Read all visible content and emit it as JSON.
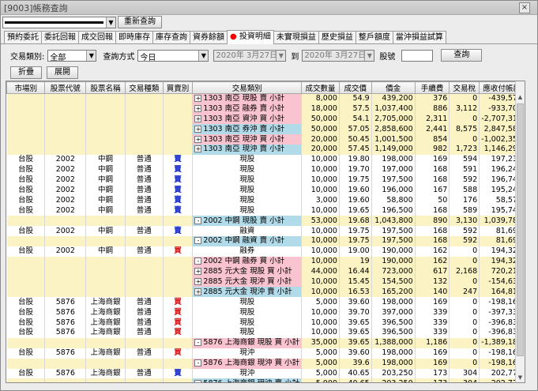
{
  "window": {
    "title": "[9003]帳務查詢",
    "close_glyph": "×"
  },
  "toolbar": {
    "account_value": "",
    "refresh_label": "重新查詢"
  },
  "tabs": [
    {
      "label": "預約委託"
    },
    {
      "label": "委託回報"
    },
    {
      "label": "成交回報"
    },
    {
      "label": "即時庫存"
    },
    {
      "label": "庫存查詢"
    },
    {
      "label": "資券餘額"
    },
    {
      "label": "投資明細",
      "active": true
    },
    {
      "label": "未實現損益"
    },
    {
      "label": "歷史損益"
    },
    {
      "label": "整戶額度"
    },
    {
      "label": "當沖損益試算"
    }
  ],
  "filter": {
    "type_label": "交易類別:",
    "type_value": "全部",
    "method_label": "查詢方式",
    "method_value": "今日",
    "date_from": "2020年 3月27日",
    "to_label": "到",
    "date_to": "2020年 3月27日",
    "stock_label": "股號",
    "stock_value": "",
    "query_label": "查詢"
  },
  "actions": {
    "collapse_label": "折疊",
    "expand_label": "展開"
  },
  "columns": [
    "市場別",
    "股票代號",
    "股票名稱",
    "交易種類",
    "買賣別",
    "交易類別",
    "成交數量",
    "成交價",
    "價金",
    "手續費",
    "交易稅",
    "應收付帳款"
  ],
  "rows": [
    {
      "kind": "sum",
      "color": "pink",
      "sign": "+",
      "label": "1303 南亞 現股 賣 小計",
      "qty": "8,000",
      "price": "54.9",
      "amt": "439,200",
      "fee": "376",
      "tax": "0",
      "net": "-439,576"
    },
    {
      "kind": "sum",
      "color": "pink",
      "sign": "+",
      "label": "1303 南亞 融券 賣 小計",
      "qty": "18,000",
      "price": "57.5",
      "amt": "1,037,400",
      "fee": "886",
      "tax": "3,112",
      "net": "-933,700"
    },
    {
      "kind": "sum",
      "color": "pink",
      "sign": "+",
      "label": "1303 南亞 資沖 買 小計",
      "qty": "50,000",
      "price": "54.1",
      "amt": "2,705,000",
      "fee": "2,311",
      "tax": "0",
      "net": "-2,707,311"
    },
    {
      "kind": "sum",
      "color": "blue",
      "sign": "+",
      "label": "1303 南亞 券沖 賣 小計",
      "qty": "50,000",
      "price": "57.05",
      "amt": "2,858,600",
      "fee": "2,441",
      "tax": "8,575",
      "net": "2,847,584"
    },
    {
      "kind": "sum",
      "color": "pink",
      "sign": "+",
      "label": "1303 南亞 現沖 買 小計",
      "qty": "20,000",
      "price": "50.45",
      "amt": "1,001,500",
      "fee": "854",
      "tax": "0",
      "net": "-1,002,354"
    },
    {
      "kind": "sum",
      "color": "blue",
      "sign": "+",
      "label": "1303 南亞 現沖 賣 小計",
      "qty": "20,000",
      "price": "57.45",
      "amt": "1,149,000",
      "fee": "982",
      "tax": "1,723",
      "net": "1,146,295"
    },
    {
      "kind": "det",
      "mkt": "台股",
      "code": "2002",
      "name": "中鋼",
      "cat": "普通",
      "side": "賣",
      "type": "現股",
      "qty": "10,000",
      "price": "19.80",
      "amt": "198,000",
      "fee": "169",
      "tax": "594",
      "net": "197,237"
    },
    {
      "kind": "det",
      "mkt": "台股",
      "code": "2002",
      "name": "中鋼",
      "cat": "普通",
      "side": "賣",
      "type": "現股",
      "qty": "10,000",
      "price": "19.70",
      "amt": "197,000",
      "fee": "168",
      "tax": "591",
      "net": "196,241"
    },
    {
      "kind": "det",
      "mkt": "台股",
      "code": "2002",
      "name": "中鋼",
      "cat": "普通",
      "side": "賣",
      "type": "現股",
      "qty": "10,000",
      "price": "19.75",
      "amt": "197,500",
      "fee": "168",
      "tax": "592",
      "net": "196,740"
    },
    {
      "kind": "det",
      "mkt": "台股",
      "code": "2002",
      "name": "中鋼",
      "cat": "普通",
      "side": "賣",
      "type": "現股",
      "qty": "10,000",
      "price": "19.60",
      "amt": "196,000",
      "fee": "167",
      "tax": "588",
      "net": "195,245"
    },
    {
      "kind": "det",
      "mkt": "台股",
      "code": "2002",
      "name": "中鋼",
      "cat": "普通",
      "side": "賣",
      "type": "現股",
      "qty": "3,000",
      "price": "19.60",
      "amt": "58,800",
      "fee": "50",
      "tax": "176",
      "net": "58,574"
    },
    {
      "kind": "det",
      "mkt": "台股",
      "code": "2002",
      "name": "中鋼",
      "cat": "普通",
      "side": "賣",
      "type": "現股",
      "qty": "10,000",
      "price": "19.65",
      "amt": "196,500",
      "fee": "168",
      "tax": "589",
      "net": "195,743"
    },
    {
      "kind": "sum",
      "color": "blue",
      "sign": "-",
      "label": "2002 中鋼 現股 賣 小計",
      "qty": "53,000",
      "price": "19.68",
      "amt": "1,043,800",
      "fee": "890",
      "tax": "3,130",
      "net": "1,039,780"
    },
    {
      "kind": "det",
      "mkt": "台股",
      "code": "2002",
      "name": "中鋼",
      "cat": "普通",
      "side": "賣",
      "type": "融資",
      "qty": "10,000",
      "price": "19.75",
      "amt": "197,500",
      "fee": "168",
      "tax": "592",
      "net": "81,699"
    },
    {
      "kind": "sum",
      "color": "blue",
      "sign": "-",
      "label": "2002 中鋼 融資 賣 小計",
      "qty": "10,000",
      "price": "19.75",
      "amt": "197,500",
      "fee": "168",
      "tax": "592",
      "net": "81,699"
    },
    {
      "kind": "det",
      "mkt": "台股",
      "code": "2002",
      "name": "中鋼",
      "cat": "普通",
      "side": "買",
      "type": "融券",
      "qty": "10,000",
      "price": "19.00",
      "amt": "190,000",
      "fee": "162",
      "tax": "0",
      "net": "194,323"
    },
    {
      "kind": "sum",
      "color": "pink",
      "sign": "-",
      "label": "2002 中鋼 融券 買 小計",
      "qty": "10,000",
      "price": "19",
      "amt": "190,000",
      "fee": "162",
      "tax": "0",
      "net": "194,323"
    },
    {
      "kind": "sum",
      "color": "pink",
      "sign": "+",
      "label": "2885 元大金 現股 買 小計",
      "qty": "44,000",
      "price": "16.44",
      "amt": "723,000",
      "fee": "617",
      "tax": "2,168",
      "net": "720,215"
    },
    {
      "kind": "sum",
      "color": "pink",
      "sign": "+",
      "label": "2885 元大金 現沖 買 小計",
      "qty": "10,000",
      "price": "15.45",
      "amt": "154,500",
      "fee": "132",
      "tax": "0",
      "net": "-154,632"
    },
    {
      "kind": "sum",
      "color": "blue",
      "sign": "+",
      "label": "2885 元大金 現沖 賣 小計",
      "qty": "10,000",
      "price": "16.53",
      "amt": "165,200",
      "fee": "140",
      "tax": "247",
      "net": "164,813"
    },
    {
      "kind": "det",
      "mkt": "台股",
      "code": "5876",
      "name": "上海商銀",
      "cat": "普通",
      "side": "買",
      "type": "現股",
      "qty": "5,000",
      "price": "39.60",
      "amt": "198,000",
      "fee": "169",
      "tax": "0",
      "net": "-198,169"
    },
    {
      "kind": "det",
      "mkt": "台股",
      "code": "5876",
      "name": "上海商銀",
      "cat": "普通",
      "side": "買",
      "type": "現股",
      "qty": "10,000",
      "price": "39.70",
      "amt": "397,000",
      "fee": "339",
      "tax": "0",
      "net": "-397,339"
    },
    {
      "kind": "det",
      "mkt": "台股",
      "code": "5876",
      "name": "上海商銀",
      "cat": "普通",
      "side": "買",
      "type": "現股",
      "qty": "10,000",
      "price": "39.65",
      "amt": "396,500",
      "fee": "339",
      "tax": "0",
      "net": "-396,839"
    },
    {
      "kind": "det",
      "mkt": "台股",
      "code": "5876",
      "name": "上海商銀",
      "cat": "普通",
      "side": "買",
      "type": "現股",
      "qty": "10,000",
      "price": "39.65",
      "amt": "396,500",
      "fee": "339",
      "tax": "0",
      "net": "-396,839"
    },
    {
      "kind": "sum",
      "color": "pink",
      "sign": "-",
      "label": "5876 上海商銀 現股 買 小計",
      "qty": "35,000",
      "price": "39.65",
      "amt": "1,388,000",
      "fee": "1,186",
      "tax": "0",
      "net": "-1,389,186"
    },
    {
      "kind": "det",
      "mkt": "台股",
      "code": "5876",
      "name": "上海商銀",
      "cat": "普通",
      "side": "買",
      "type": "現沖",
      "qty": "5,000",
      "price": "39.60",
      "amt": "198,000",
      "fee": "169",
      "tax": "0",
      "net": "-198,169"
    },
    {
      "kind": "sum",
      "color": "pink",
      "sign": "-",
      "label": "5876 上海商銀 現沖 買 小計",
      "qty": "5,000",
      "price": "39.6",
      "amt": "198,000",
      "fee": "169",
      "tax": "0",
      "net": "-198,169"
    },
    {
      "kind": "det",
      "mkt": "台股",
      "code": "5876",
      "name": "上海商銀",
      "cat": "普通",
      "side": "賣",
      "type": "現沖",
      "qty": "5,000",
      "price": "40.65",
      "amt": "203,250",
      "fee": "173",
      "tax": "304",
      "net": "202,773"
    },
    {
      "kind": "sum",
      "color": "blue",
      "sign": "-",
      "label": "5876 上海商銀 現沖 賣 小計",
      "qty": "5,000",
      "price": "40.65",
      "amt": "203,250",
      "fee": "173",
      "tax": "304",
      "net": "202,773"
    }
  ],
  "colors": {
    "subtotal_buy": "#f9c3cf",
    "subtotal_sell": "#b2dbea",
    "row_highlight": "#fbf3c4",
    "buy_text": "#1a2fc9",
    "sell_text": "#d51616"
  },
  "icons": {
    "expand": "plus-box-icon",
    "collapse": "minus-box-icon",
    "dropdown": "dropdown-arrow-icon"
  }
}
